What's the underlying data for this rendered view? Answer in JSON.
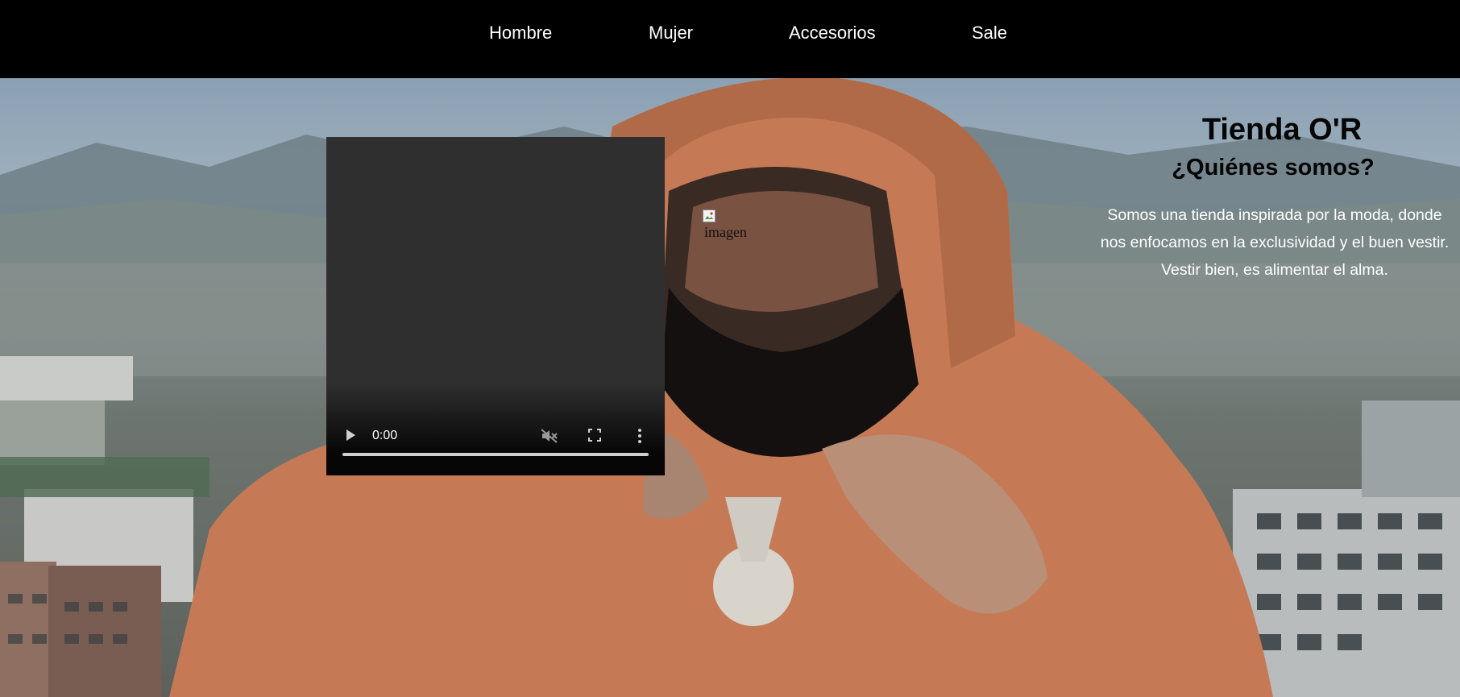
{
  "nav": {
    "items": [
      {
        "label": "Hombre"
      },
      {
        "label": "Mujer"
      },
      {
        "label": "Accesorios"
      },
      {
        "label": "Sale"
      }
    ]
  },
  "video": {
    "time": "0:00",
    "icons": {
      "play": "play-icon",
      "mute": "muted-speaker-icon",
      "fullscreen": "fullscreen-icon",
      "more": "more-options-icon"
    }
  },
  "image": {
    "alt": "imagen",
    "icon": "broken-image-icon"
  },
  "about": {
    "title": "Tienda O'R",
    "subtitle": "¿Quiénes somos?",
    "lines": [
      "Somos una tienda inspirada por la moda, donde",
      "nos enfocamos en la exclusividad y el buen vestir.",
      "Vestir bien, es alimentar el alma."
    ]
  },
  "colors": {
    "nav_bg": "#000000",
    "nav_text": "#ffffff",
    "video_bg": "#2f2f2f",
    "hoodie": "#c97b55"
  }
}
